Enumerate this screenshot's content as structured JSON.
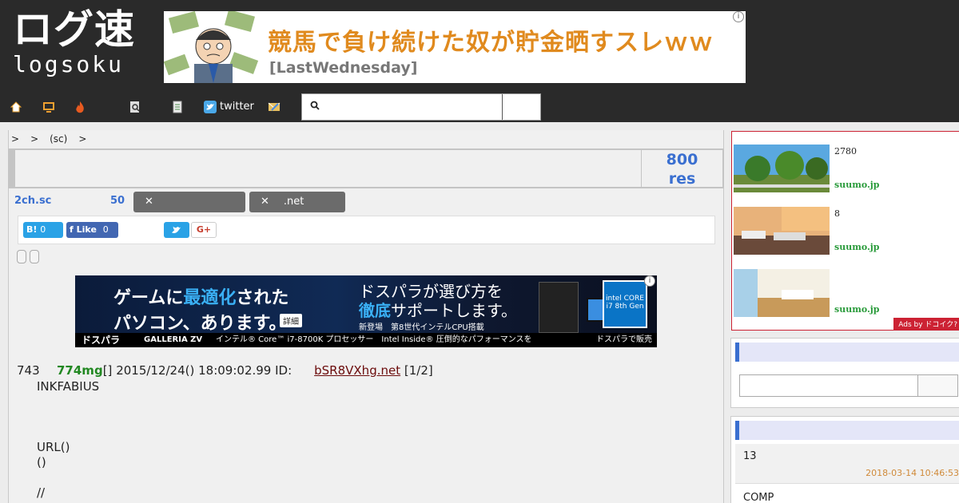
{
  "header": {
    "logo_main": "ログ速",
    "logo_sub": "logsoku",
    "banner": {
      "title": "競馬で負け続けた奴が貯金晒すスレｗｗ",
      "source": "[LastWednesday]",
      "info": "i"
    },
    "nav": [
      {
        "icon": "home-icon",
        "label": "",
        "color": "#ffffff"
      },
      {
        "icon": "monitor-icon",
        "label": "",
        "color": "#f0a030"
      },
      {
        "icon": "fire-icon",
        "label": "",
        "color": "#e85a20"
      },
      {
        "icon": "search-doc-icon",
        "label": "",
        "color": "#dddddd"
      },
      {
        "icon": "list-icon",
        "label": "",
        "color": "#dddddd"
      },
      {
        "icon": "twitter-icon",
        "label": "twitter",
        "color": "#4aa8e8"
      },
      {
        "icon": "mail-icon",
        "label": "",
        "color": "#e8c060"
      }
    ],
    "search": {
      "placeholder": "",
      "button_label": ""
    }
  },
  "breadcrumb": [
    ">",
    ">",
    "(sc)",
    ">"
  ],
  "thread": {
    "title": "",
    "res_count": "800",
    "res_label": "res",
    "board": "2ch.sc",
    "count": "50",
    "tags": [
      {
        "label": ""
      },
      {
        "label": ".net"
      }
    ],
    "share": {
      "hatena_label": "B!",
      "hatena_count": "0",
      "fb_label": "Like",
      "fb_count": "0",
      "gplus_label": "G+"
    }
  },
  "ad2": {
    "line1_a": "ゲームに",
    "line1_hl": "最適化",
    "line1_b": "された",
    "line2": "パソコン、あります。",
    "detail": "詳細",
    "right1": "ドスパラが選び方を",
    "right2_hl": "徹底",
    "right2_b": "サポートします。",
    "right3": "新登場　第8世代インテルCPU搭載",
    "intel": "intel CORE i7 8th Gen",
    "foot_brand": "ドスパラ",
    "foot_model": "GALLERIA ZV",
    "foot_cpu": "インテル® Core™ i7-8700K プロセッサー　Intel Inside® 圧倒的なパフォーマンスを",
    "foot_right": "ドスパラで販売中",
    "info": "i"
  },
  "post": {
    "num": "743",
    "name": "774mg",
    "mail": "[]",
    "date": "2015/12/24() 18:09:02.99 ID:",
    "id": "bSR8VXhg.net",
    "page": "[1/2]",
    "lines": [
      "INKFABIUS",
      "",
      "",
      "",
      "URL()",
      "()",
      "",
      "//"
    ]
  },
  "sidebar": {
    "ads": [
      {
        "text": "2780",
        "source": "suumo.jp"
      },
      {
        "text": "8",
        "source": "suumo.jp"
      },
      {
        "text": "",
        "source": "suumo.jp"
      }
    ],
    "ads_tag": "Ads by ドコイク?",
    "feed": [
      {
        "title": "13",
        "date": "2018-03-14 10:46:53"
      },
      {
        "title": "COMP",
        "date": ""
      }
    ]
  }
}
